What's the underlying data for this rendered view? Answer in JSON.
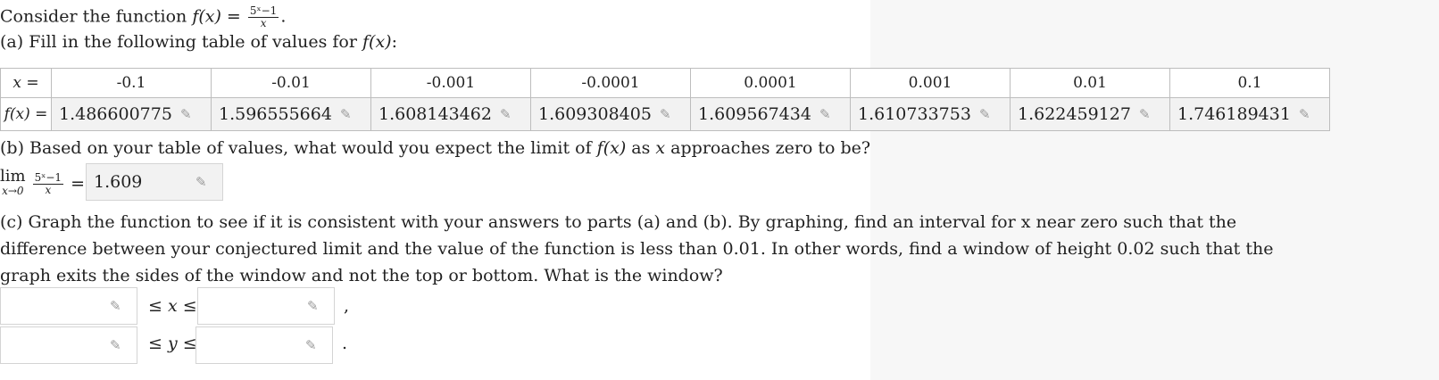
{
  "intro": {
    "prefix": "Consider the function",
    "func_lhs": "f(x) =",
    "frac_num": "5ˣ−1",
    "frac_den": "x",
    "suffix": "."
  },
  "part_a": {
    "text": "(a) Fill in the following table of values for",
    "func": "f(x)",
    "colon": ":"
  },
  "table": {
    "x_label": "x =",
    "f_label": "f(x) =",
    "x_values": [
      "-0.1",
      "-0.01",
      "-0.001",
      "-0.0001",
      "0.0001",
      "0.001",
      "0.01",
      "0.1"
    ],
    "f_values": [
      "1.486600775",
      "1.596555664",
      "1.608143462",
      "1.609308405",
      "1.609567434",
      "1.610733753",
      "1.622459127",
      "1.746189431"
    ]
  },
  "part_b": {
    "text_before": "(b) Based on your table of values, what would you expect the limit of",
    "func": "f(x)",
    "text_mid": "as",
    "var": "x",
    "text_after": "approaches zero to be?",
    "lim": "lim",
    "lim_sub": "x→0",
    "frac_num": "5ˣ−1",
    "frac_den": "x",
    "equals": "=",
    "answer": "1.609"
  },
  "part_c": {
    "text": "(c) Graph the function to see if it is consistent with your answers to parts (a) and (b). By graphing, find an interval for x near zero such that the difference between your conjectured limit and the value of the function is less than 0.01. In other words, find a window of height 0.02 such that the graph exits the sides of the window and not the top or bottom. What is the window?",
    "x_ineq": "≤ x ≤",
    "y_ineq": "≤ y ≤",
    "comma": ",",
    "period": ".",
    "x_min": "",
    "x_max": "",
    "y_min": "",
    "y_max": ""
  }
}
